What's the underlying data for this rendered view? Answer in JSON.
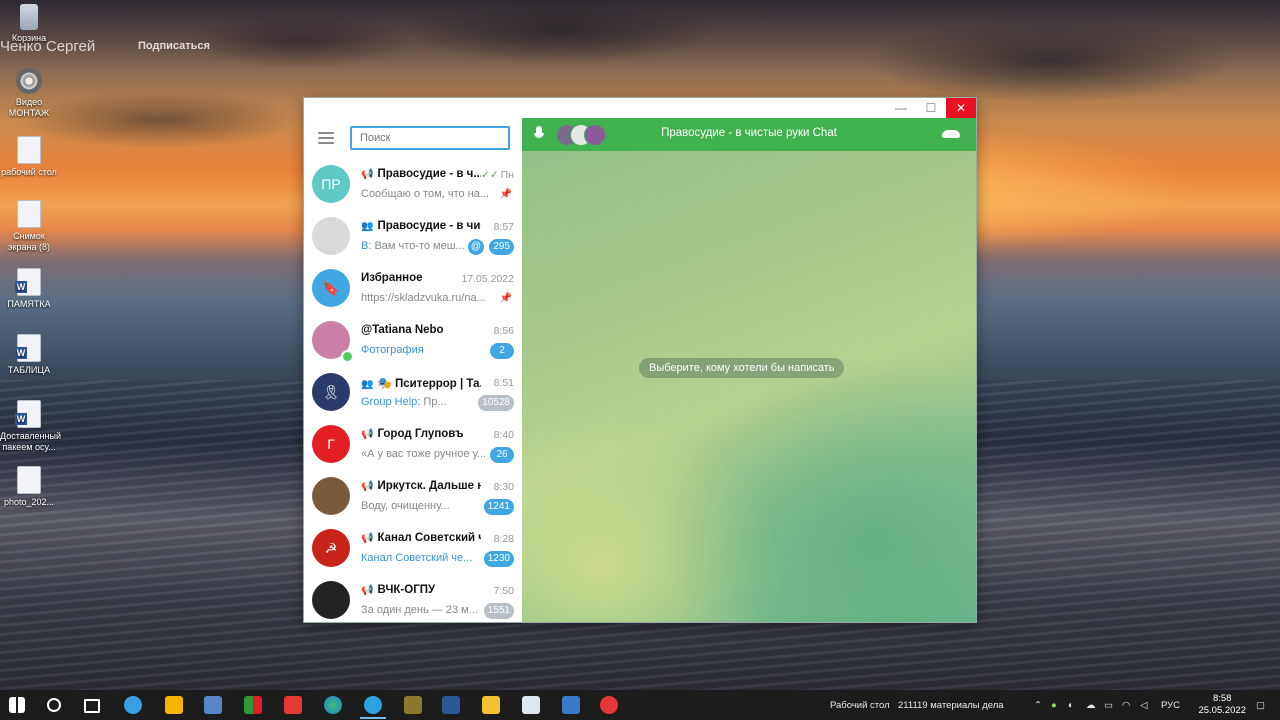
{
  "desktop": {
    "background_name": "Ченко Сергей",
    "background_sub": "Подписаться",
    "icons": [
      {
        "label": "Корзина",
        "icon": "recycle-bin-icon"
      },
      {
        "label": "Видео МОНТАЖ",
        "icon": "video-icon"
      },
      {
        "label": "рабочий стол",
        "icon": "file-icon"
      },
      {
        "label": "Снимок экрана (8)",
        "icon": "file-icon"
      },
      {
        "label": "ПАМЯТКА",
        "icon": "word-doc-icon"
      },
      {
        "label": "ТАБЛИЦА",
        "icon": "word-doc-icon"
      },
      {
        "label": "Доставленный пакеем осу...",
        "icon": "word-doc-icon"
      },
      {
        "label": "photo_202...",
        "icon": "file-icon"
      }
    ]
  },
  "window": {
    "controls": {
      "minimize": "—",
      "maximize": "☐",
      "close": "✕"
    },
    "search_placeholder": "Поиск",
    "chats": [
      {
        "kind": "📢",
        "title": "Правосудие - в ч...",
        "time": "Пн",
        "check": "✓✓",
        "preview": "Сообщаю о том, что на...",
        "pinned": "📌",
        "avatar_text": "ПР",
        "avatar_color": "#5fc9c6"
      },
      {
        "kind": "👥",
        "title": "Правосудие - в чис...",
        "time": "8:57",
        "preview_hl": "В:",
        "preview": "Вам что-то меш...",
        "mention": "@",
        "badge": "295",
        "avatar_text": "",
        "avatar_color": "#d9d9d9"
      },
      {
        "title": "Избранное",
        "time": "17.05.2022",
        "preview": "https://skladzvuka.ru/na...",
        "pinned": "📌",
        "avatar_text": "🔖",
        "avatar_color": "#40a7e3"
      },
      {
        "title": "@Tatiana Nebo",
        "time": "8:56",
        "preview_hl": "Фотография",
        "badge": "2",
        "avatar_text": "",
        "avatar_color": "#c97fa6",
        "online": true
      },
      {
        "kind": "👥",
        "title": "🎭 Пситеррор | Та...",
        "time": "8:51",
        "preview_hl": "Group Help:",
        "preview": "Пр...",
        "badge": "10528",
        "badge_muted": true,
        "avatar_text": "🎗",
        "avatar_color": "#2a3a6a"
      },
      {
        "kind": "📢",
        "title": "Город Глуповъ",
        "time": "8:40",
        "preview": "«А у вас тоже ручное у...",
        "badge": "26",
        "avatar_text": "Г",
        "avatar_color": "#e31e24"
      },
      {
        "kind": "📢",
        "title": "Иркутск. Дальше н...",
        "time": "8:30",
        "preview": "Воду, очищенну...",
        "badge": "1241",
        "avatar_text": "",
        "avatar_color": "#7a5a3a"
      },
      {
        "kind": "📢",
        "title": "Канал Советский ч...",
        "time": "8:28",
        "preview_hl": "Канал Советский че...",
        "badge": "1230",
        "avatar_text": "☭",
        "avatar_color": "#c8231b"
      },
      {
        "kind": "📢",
        "title": "ВЧК-ОГПУ",
        "time": "7:50",
        "preview": "За один день — 23 м...",
        "badge": "1551",
        "badge_muted": true,
        "avatar_text": "",
        "avatar_color": "#222"
      }
    ],
    "call_bar": {
      "title": "Правосудие - в чистые руки Chat",
      "color": "#3fb24f"
    },
    "empty_state": "Выберите, кому хотели бы написать"
  },
  "taskbar": {
    "tray_label_1": "Рабочий стол",
    "tray_label_2": "211119 материалы дела",
    "language": "РУС",
    "time": "8:58",
    "date": "25.05.2022"
  }
}
